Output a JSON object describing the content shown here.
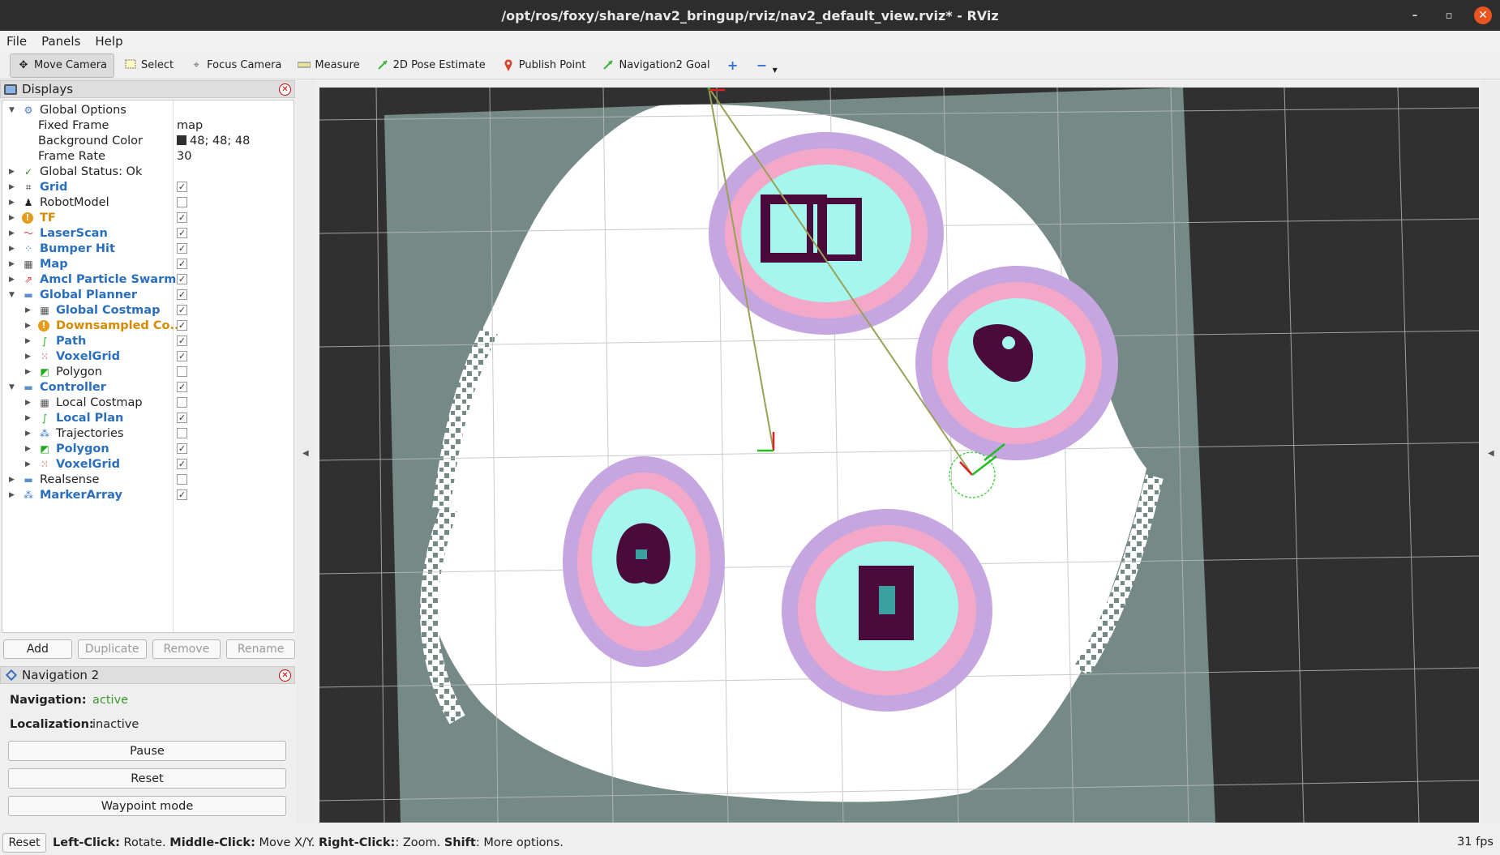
{
  "window": {
    "title": "/opt/ros/foxy/share/nav2_bringup/rviz/nav2_default_view.rviz* - RViz",
    "minimize": "–",
    "maximize": "▫",
    "close": "✕"
  },
  "menu": {
    "file": "File",
    "panels": "Panels",
    "help": "Help"
  },
  "toolbar": {
    "move_camera": "Move Camera",
    "select": "Select",
    "focus_camera": "Focus Camera",
    "measure": "Measure",
    "pose_estimate": "2D Pose Estimate",
    "publish_point": "Publish Point",
    "nav_goal": "Navigation2 Goal",
    "add_icon": "+",
    "remove_icon": "−"
  },
  "displays": {
    "title": "Displays",
    "global_options": "Global Options",
    "fixed_frame_label": "Fixed Frame",
    "fixed_frame_value": "map",
    "bg_color_label": "Background Color",
    "bg_color_value": "48; 48; 48",
    "bg_color_hex": "#303030",
    "frame_rate_label": "Frame Rate",
    "frame_rate_value": "30",
    "global_status": "Global Status: Ok",
    "items": [
      {
        "label": "Grid",
        "checked": "✓"
      },
      {
        "label": "RobotModel",
        "checked": ""
      },
      {
        "label": "TF",
        "checked": "✓"
      },
      {
        "label": "LaserScan",
        "checked": "✓"
      },
      {
        "label": "Bumper Hit",
        "checked": "✓"
      },
      {
        "label": "Map",
        "checked": "✓"
      },
      {
        "label": "Amcl Particle Swarm",
        "checked": "✓"
      },
      {
        "label": "Global Planner",
        "checked": "✓"
      },
      {
        "label": "Global Costmap",
        "checked": "✓"
      },
      {
        "label": "Downsampled Co...",
        "checked": "✓"
      },
      {
        "label": "Path",
        "checked": "✓"
      },
      {
        "label": "VoxelGrid",
        "checked": "✓"
      },
      {
        "label": "Polygon",
        "checked": ""
      },
      {
        "label": "Controller",
        "checked": "✓"
      },
      {
        "label": "Local Costmap",
        "checked": ""
      },
      {
        "label": "Local Plan",
        "checked": "✓"
      },
      {
        "label": "Trajectories",
        "checked": ""
      },
      {
        "label": "Polygon",
        "checked": "✓"
      },
      {
        "label": "VoxelGrid",
        "checked": "✓"
      },
      {
        "label": "Realsense",
        "checked": ""
      },
      {
        "label": "MarkerArray",
        "checked": "✓"
      }
    ],
    "buttons": {
      "add": "Add",
      "duplicate": "Duplicate",
      "remove": "Remove",
      "rename": "Rename"
    }
  },
  "navigation2": {
    "title": "Navigation 2",
    "nav_label": "Navigation:",
    "nav_value": "active",
    "loc_label": "Localization:",
    "loc_value": "inactive",
    "pause": "Pause",
    "reset": "Reset",
    "waypoint": "Waypoint mode"
  },
  "status": {
    "reset": "Reset",
    "left_click": "Left-Click:",
    "left_desc": " Rotate. ",
    "middle_click": "Middle-Click:",
    "middle_desc": " Move X/Y. ",
    "right_click": "Right-Click:",
    "right_desc": ": Zoom. ",
    "shift": "Shift",
    "shift_desc": ": More options.",
    "fps": "31 fps"
  },
  "colors": {
    "active_green": "#3a9a2a",
    "display_blue": "#2a6fbf",
    "warn_orange": "#d58a00",
    "map_unknown": "#758a86",
    "obstacle": "#4a0a3c",
    "inflation_cyan": "#a4f6ee",
    "inflation_pink": "#f3a8c8",
    "inflation_lavender": "#c6a6e0"
  }
}
